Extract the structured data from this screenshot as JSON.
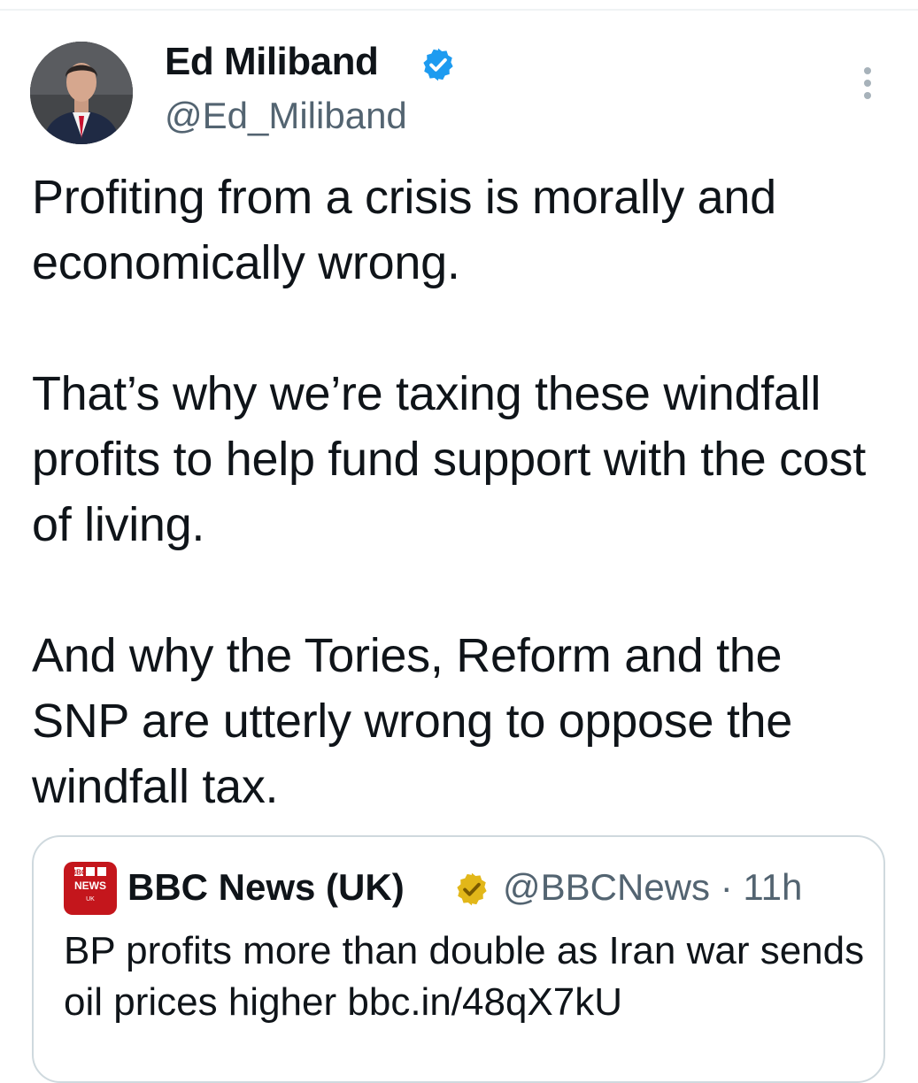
{
  "tweet": {
    "author_name": "Ed Miliband",
    "author_handle": "@Ed_Miliband",
    "verified_icon": "verified-badge-icon",
    "verified_color": "#1d9bf0",
    "more_icon": "more-vertical-icon",
    "paragraphs": [
      "Profiting from a crisis is morally and economically wrong.",
      "That’s why we’re taxing these windfall profits to help fund support with the cost of living.",
      "And why the Tories, Reform and the SNP are utterly wrong to oppose the windfall tax."
    ]
  },
  "quote": {
    "avatar_text": [
      "BBC",
      "NEWS",
      "UK"
    ],
    "avatar_color": "#c4161c",
    "author_name": "BBC News (UK)",
    "verified_icon": "gold-verified-badge-icon",
    "verified_color": "#e2b719",
    "author_handle": "@BBCNews",
    "separator": "·",
    "time": "11h",
    "text": "BP profits more than double as Iran war sends oil prices higher bbc.in/48qX7kU"
  }
}
